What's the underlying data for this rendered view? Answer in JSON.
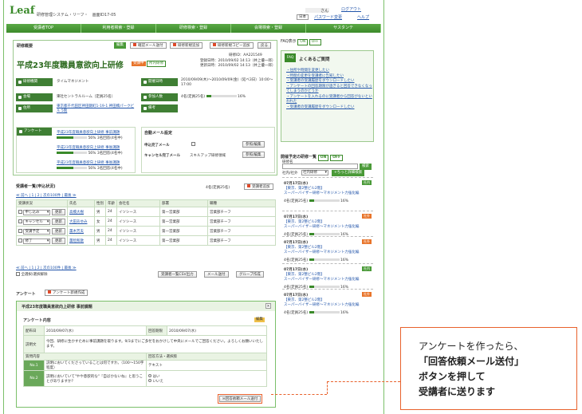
{
  "header": {
    "logo": "Leaf",
    "system_name": "研修管理システム・リーフ・",
    "screen_id": "画面ID17-05",
    "user_suffix": "さん",
    "logout": "ログアウト",
    "lang": "日本",
    "pw_change": "パスワード変更",
    "help": "ヘルプ"
  },
  "nav": [
    "受講者TOP",
    "利用者検索・登録",
    "研修検索・登録",
    "会場検索・登録",
    "サスタンテ"
  ],
  "overview": {
    "header": "研修概要",
    "edit": "編集",
    "btn_mail": "確認メール送付",
    "btn_copy_add": "研修新規追加",
    "btn_copy": "研修新規コピー追加",
    "btn_back": "戻る",
    "code_label": "研修ID",
    "code": "AA221549",
    "title": "平成23年度職員意欲向上研修",
    "tag1": "受講中",
    "tag2": "所内研修",
    "created": "登録日時：2010/09/02 14:13（井上優一郎）",
    "updated": "更新日時：2010/09/02 14:13（井上優一郎）",
    "lbl_org": "研修機関",
    "org": "タイムマネジメント",
    "lbl_date": "開催日時",
    "date": "2010/09/09(木)〜2010/09/09(金)（延べ3日）10:00〜17:00",
    "lbl_venue": "会場",
    "venue": "東社セントラルルーム（定員25名）",
    "lbl_people": "参加人数",
    "people": "4名(定員25名)",
    "people_pct": "16%",
    "lbl_addr": "住所",
    "addr": "東京都千代田区神田錦町1-19-1 神田橋パークビル 5階",
    "lbl_note": "備考"
  },
  "survey_box": {
    "label": "アンケート",
    "items": [
      {
        "name": "平成23年度職員意欲向上研修 事前課題",
        "pct": "56%",
        "count": "3名回答(4名中)"
      },
      {
        "name": "平成23年度職員意欲向上研修 事後課題",
        "pct": "56%",
        "count": "3名回答(4名中)"
      },
      {
        "name": "平成23年度職員意欲向上研修 事後課題",
        "pct": "56%",
        "count": "3名回答(4名中)"
      }
    ]
  },
  "auto_mail": {
    "label": "自動メール設定",
    "row1": "申込完了メール",
    "row2": "キャンセル完了メール",
    "row2_val": "スキルアップ研修領域",
    "edit": "参照/編集"
  },
  "students": {
    "header": "受講者一覧(申込状況)",
    "count": "4名(定員25名)",
    "add": "受講者追加",
    "pager": "≪ 前へ | 1 | 2 | 次の100件 | 最後 ≫",
    "cols": [
      "受講状況",
      "",
      "氏名",
      "性別",
      "年齢",
      "会社名",
      "部署",
      "職種"
    ],
    "rows": [
      {
        "status": "申し込み",
        "name": "高橋大樹",
        "sex": "男",
        "age": "24",
        "company": "イソシース",
        "dept": "第一営業部",
        "job": "営業部チーフ"
      },
      {
        "status": "キャンセル",
        "name": "大田あゆみ",
        "sex": "女",
        "age": "24",
        "company": "イソシース",
        "dept": "第一営業部",
        "job": "営業部チーフ"
      },
      {
        "status": "受講予定",
        "name": "薫木芳夫",
        "sex": "男",
        "age": "24",
        "company": "イソシース",
        "dept": "第一営業部",
        "job": "営業部チーフ"
      },
      {
        "status": "修了",
        "name": "薫暗和歌",
        "sex": "男",
        "age": "24",
        "company": "イソシース",
        "dept": "第一営業部",
        "job": "営業部チーフ"
      }
    ],
    "update": "更新",
    "select_all": "全選択/選択解除",
    "csv": "受講者一覧CSV出力",
    "mail": "メール送付",
    "group": "グループ作成"
  },
  "survey_section": {
    "label": "アンケート",
    "new": "アンケート新規作成",
    "title": "平成23年度職員意欲向上研修 事前課題",
    "content_label": "アンケート内容",
    "edit": "編集",
    "date_label": "配布日",
    "date": "2010/09/07(水)",
    "deadline_label": "回答期限",
    "deadline": "2010/09/07(水)",
    "desc_label": "説明文",
    "desc": "今回、研修に生かすために事前課題を取ります。9/3までにご多忙をおかけして中央にメールでご回答ください。よろしくお願いいたします。",
    "q_label": "質問内容",
    "type_label": "回答方法・選択肢",
    "q1_no": "No.1",
    "q1": "説明においてくださっていることは何ですか。（100〜150字程度）",
    "q1_type": "テキスト",
    "q2_no": "No.2",
    "q2": "説明においていて\"やや意欲的な\"『自ばかないね』と思うことがありますか？",
    "opt1": "はい",
    "opt2": "いいえ",
    "send_btn": "回答依頼メール送付"
  },
  "faq": {
    "top": "FAQ表示",
    "on": "ON",
    "off": "OFF",
    "badge": "FAQ",
    "title": "よくあるご質問",
    "items": [
      "・住所や時間を変更したい",
      "・時間の変更を受講者に告知したい",
      "・受講者の受講履歴をダウンロードしたい",
      "・アンケートの回答期限が過ぎると回答できなくなってしまうのかどうか",
      "・アンケートを入れるのに受講者から回答がないといわれた",
      "・受講者の受講履歴をダウンロードしたい"
    ]
  },
  "upcoming": {
    "header": "開催予定の研修一覧",
    "on": "ON",
    "off": "OFF",
    "search_label": "研修名",
    "search_btn": "検索",
    "filter_label": "社内/社外",
    "filter_val": "社内研修",
    "filter_btn": "+ちっと詳細検索",
    "events": [
      {
        "date": "07月17日(水)",
        "place": "【東京、第2整ビル2階】",
        "name": "スーパーバイザー研修〜マネジメント力強化編",
        "people": "4名(定員25名)",
        "pct": "16%",
        "badge": "社内"
      },
      {
        "date": "07月17日(水)",
        "place": "【東京、第2整ビル2階】",
        "name": "スーパーバイザー研修〜マネジメント力強化編",
        "people": "4名(定員25名)",
        "pct": "16%",
        "badge": "社外"
      },
      {
        "date": "07月17日(水)",
        "place": "【東京、第2整ビル2階】",
        "name": "スーパーバイザー研修〜マネジメント力強化編",
        "people": "4名(定員25名)",
        "pct": "16%",
        "badge": "社外"
      },
      {
        "date": "07月17日(水)",
        "place": "【東京、第2整ビル2階】",
        "name": "スーパーバイザー研修〜マネジメント力強化編",
        "people": "4名(定員25名)",
        "pct": "16%",
        "badge": "社内"
      },
      {
        "date": "07月17日(水)",
        "place": "【東京、第2整ビル2階】",
        "name": "スーパーバイザー研修〜マネジメント力強化編",
        "people": "4名(定員25名)",
        "pct": "16%",
        "badge": "社外"
      }
    ]
  },
  "callout": {
    "line1": "アンケートを作ったら、",
    "line2": "「回答依頼メール送付」",
    "line3": "ボタンを押して",
    "line4": "受講者に送ります"
  }
}
